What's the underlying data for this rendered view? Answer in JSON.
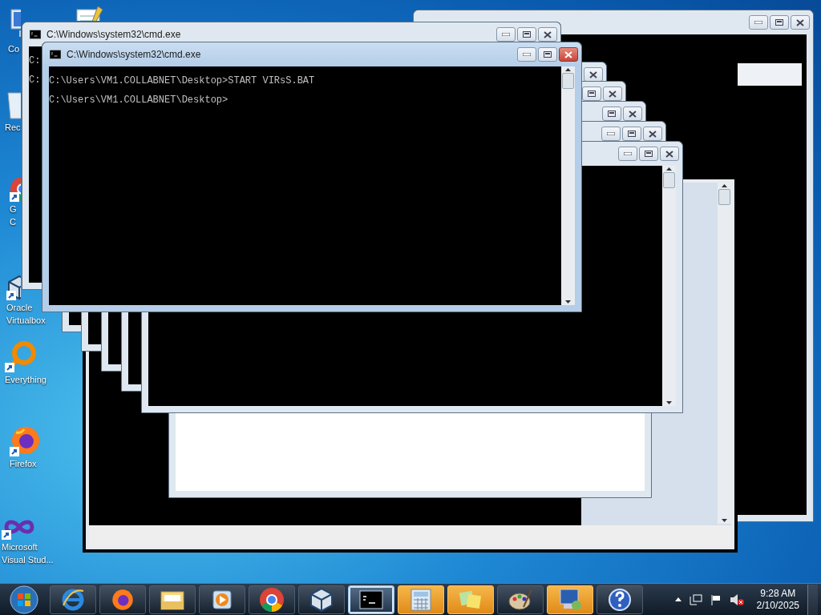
{
  "desktop_icons": [
    {
      "kind": "computer",
      "lines": [
        "Co"
      ]
    },
    {
      "kind": "notepad"
    },
    {
      "kind": "recycle",
      "lines": [
        "Rec"
      ]
    },
    {
      "kind": "chrome",
      "lines": [
        "G",
        "C"
      ]
    },
    {
      "kind": "virtualbox",
      "lines": [
        "Oracle",
        "Virtualbox"
      ]
    },
    {
      "kind": "everything",
      "lines": [
        "Everything"
      ]
    },
    {
      "kind": "firefox",
      "lines": [
        "Firefox"
      ]
    },
    {
      "kind": "vstudio",
      "lines": [
        "Microsoft",
        "Visual Stud..."
      ]
    }
  ],
  "windows": [
    {
      "kind": "app",
      "active": false
    },
    {
      "kind": "panel",
      "active": false
    },
    {
      "kind": "blank",
      "active": false
    },
    {
      "kind": "console",
      "active": false
    },
    {
      "kind": "console",
      "active": false
    },
    {
      "kind": "console",
      "active": false
    },
    {
      "kind": "console",
      "active": false
    },
    {
      "kind": "console",
      "active": false
    },
    {
      "kind": "console",
      "active": false,
      "title": "C:\\Windows\\system32\\cmd.exe",
      "lines": [
        "C:",
        "C:"
      ]
    },
    {
      "kind": "console",
      "active": true,
      "title": "C:\\Windows\\system32\\cmd.exe",
      "lines": [
        "C:\\Users\\VM1.COLLABNET\\Desktop>START VIRsS.BAT",
        "C:\\Users\\VM1.COLLABNET\\Desktop>"
      ]
    }
  ],
  "taskbar": {
    "items": [
      {
        "kind": "ie",
        "selected": false,
        "flashing": false
      },
      {
        "kind": "firefox",
        "selected": false,
        "flashing": false
      },
      {
        "kind": "folder",
        "selected": false,
        "flashing": false
      },
      {
        "kind": "media",
        "selected": false,
        "flashing": false
      },
      {
        "kind": "chrome",
        "selected": false,
        "flashing": false
      },
      {
        "kind": "virtualbox",
        "selected": false,
        "flashing": false
      },
      {
        "kind": "cmd",
        "selected": true,
        "flashing": false
      },
      {
        "kind": "calculator",
        "selected": false,
        "flashing": true
      },
      {
        "kind": "notes",
        "selected": false,
        "flashing": true
      },
      {
        "kind": "paint",
        "selected": false,
        "flashing": false
      },
      {
        "kind": "remote",
        "selected": false,
        "flashing": true
      },
      {
        "kind": "help",
        "selected": false,
        "flashing": false
      }
    ],
    "tray": {
      "volume_muted": true
    },
    "clock": {
      "time": "9:28 AM",
      "date": "2/10/2025"
    }
  }
}
